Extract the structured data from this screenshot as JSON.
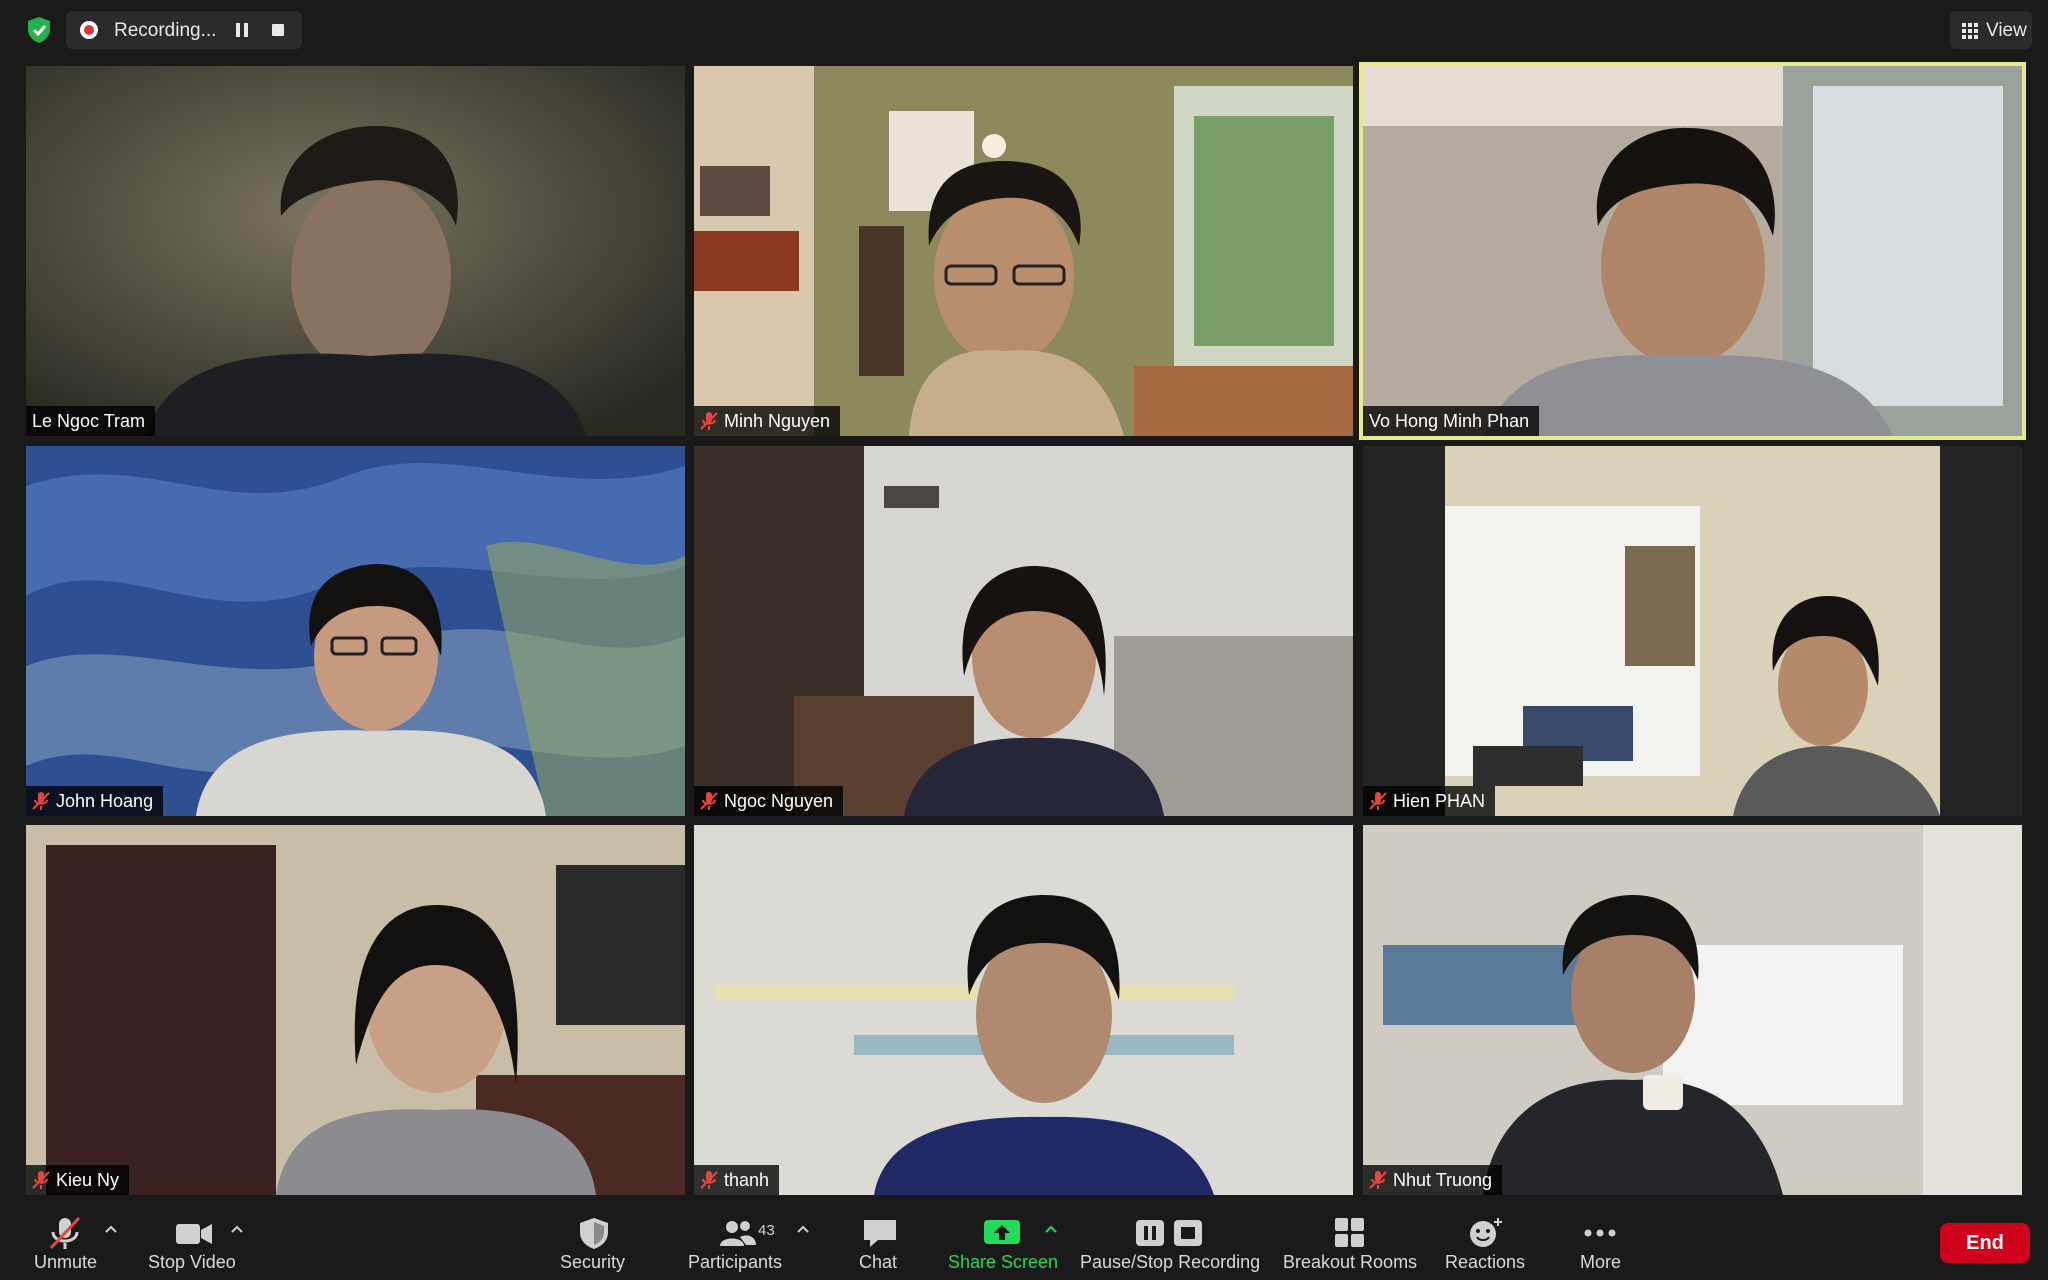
{
  "top_bar": {
    "recording_label": "Recording...",
    "view_label": "View"
  },
  "participants_grid": [
    {
      "name": "Le Ngoc Tram",
      "muted": false,
      "active_speaker": false
    },
    {
      "name": "Minh Nguyen",
      "muted": true,
      "active_speaker": false
    },
    {
      "name": "Vo Hong Minh Phan",
      "muted": false,
      "active_speaker": true
    },
    {
      "name": "John Hoang",
      "muted": true,
      "active_speaker": false
    },
    {
      "name": "Ngoc Nguyen",
      "muted": true,
      "active_speaker": false
    },
    {
      "name": "Hien PHAN",
      "muted": true,
      "active_speaker": false
    },
    {
      "name": "Kieu Ny",
      "muted": true,
      "active_speaker": false
    },
    {
      "name": "thanh",
      "muted": true,
      "active_speaker": false
    },
    {
      "name": "Nhut Truong",
      "muted": true,
      "active_speaker": false
    }
  ],
  "toolbar": {
    "unmute_label": "Unmute",
    "stop_video_label": "Stop Video",
    "security_label": "Security",
    "participants_label": "Participants",
    "participants_count": "43",
    "chat_label": "Chat",
    "share_screen_label": "Share Screen",
    "pause_stop_recording_label": "Pause/Stop Recording",
    "breakout_rooms_label": "Breakout Rooms",
    "reactions_label": "Reactions",
    "more_label": "More",
    "end_label": "End"
  },
  "colors": {
    "background": "#1a1a1a",
    "active_speaker_border": "#e6eb8a",
    "share_screen_green": "#23d959",
    "end_red": "#d0021b",
    "recording_red": "#e0363a",
    "muted_red": "#e8453c"
  }
}
